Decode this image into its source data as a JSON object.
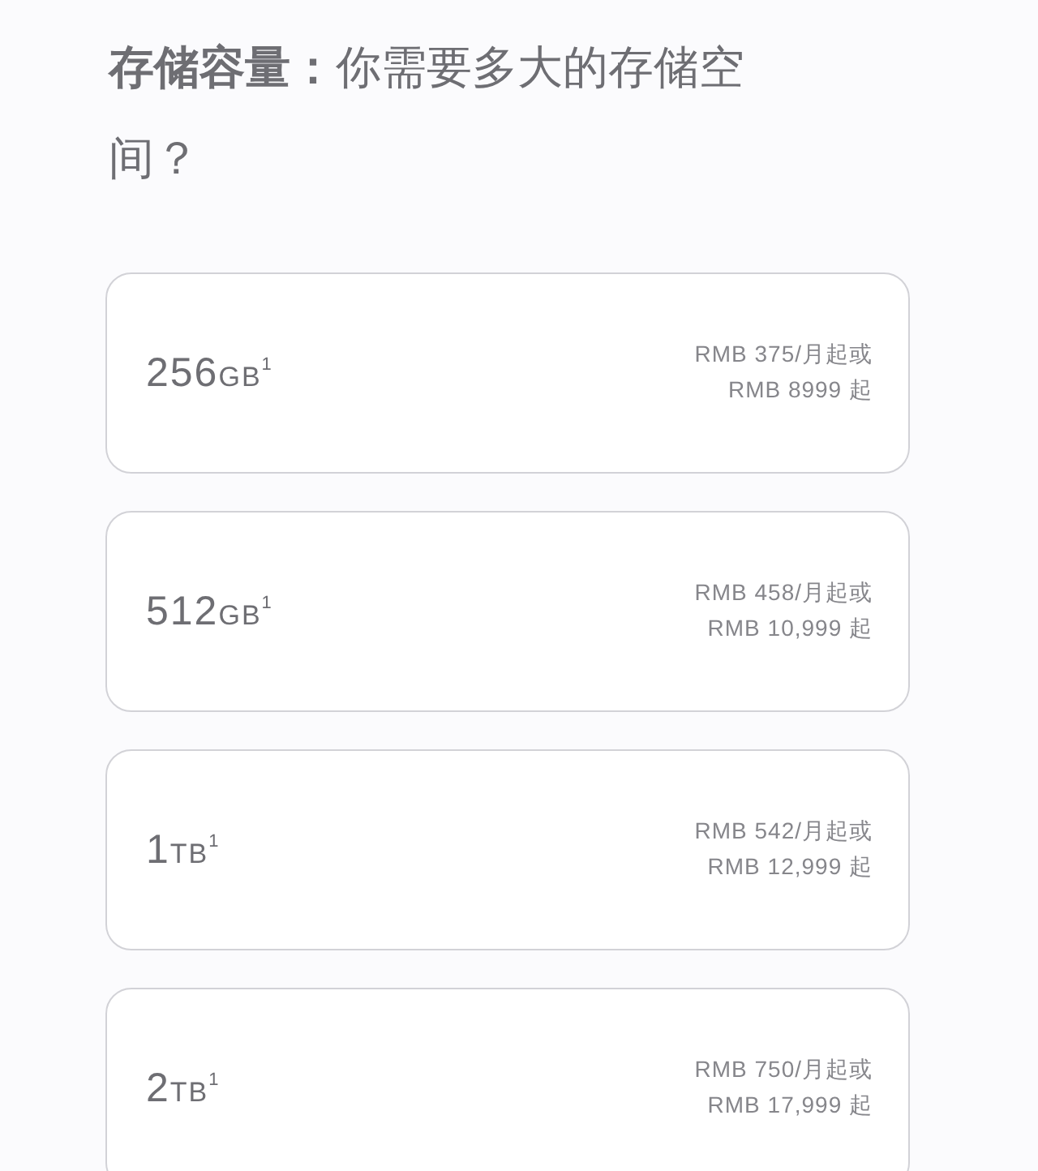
{
  "heading": "**存储容量：**你需要多大的存储空间？",
  "options": [
    {
      "size": "256",
      "unit": "GB",
      "footnote": "1",
      "monthly": "RMB 375/月起或",
      "price": "RMB 8999 起"
    },
    {
      "size": "512",
      "unit": "GB",
      "footnote": "1",
      "monthly": "RMB 458/月起或",
      "price": "RMB 10,999 起"
    },
    {
      "size": "1",
      "unit": "TB",
      "footnote": "1",
      "monthly": "RMB 542/月起或",
      "price": "RMB 12,999 起"
    },
    {
      "size": "2",
      "unit": "TB",
      "footnote": "1",
      "monthly": "RMB 750/月起或",
      "price": "RMB 17,999 起"
    }
  ]
}
